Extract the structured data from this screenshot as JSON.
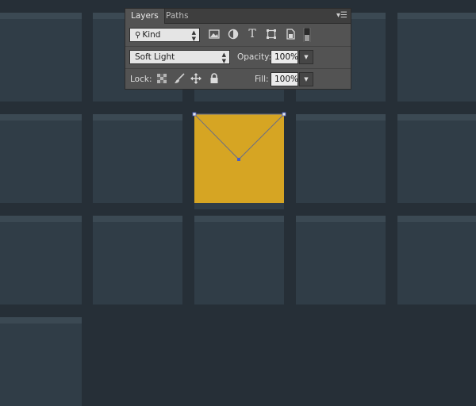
{
  "panel": {
    "tabs": [
      {
        "label": "Layers",
        "active": true
      },
      {
        "label": "Paths",
        "active": false
      }
    ],
    "menu_icon": "panel-menu-icon",
    "filter": {
      "kind_label": "Kind",
      "icons": [
        "pixel-layer-filter-icon",
        "adjustment-layer-filter-icon",
        "type-layer-filter-icon",
        "shape-layer-filter-icon",
        "smart-object-filter-icon",
        "filter-toggle-icon"
      ]
    },
    "blend_mode": "Soft Light",
    "opacity_label": "Opacity:",
    "opacity_value": "100%",
    "lock_label": "Lock:",
    "lock_icons": [
      "lock-transparent-pixels-icon",
      "lock-image-pixels-icon",
      "lock-position-icon",
      "lock-all-icon"
    ],
    "fill_label": "Fill:",
    "fill_value": "100%"
  },
  "colors": {
    "background": "#262f37",
    "tile": "#303d47",
    "tile_highlight": "#3b4953",
    "selected_square": "#d6a523",
    "path_anchor": "#4a5fc4"
  }
}
